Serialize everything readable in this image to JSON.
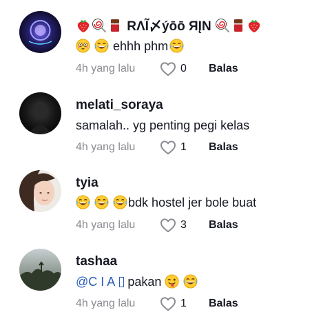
{
  "comments": [
    {
      "username": "RΛĨ〆ýōō ЯĮN",
      "text": "ehhh phm",
      "time": "4h yang lalu",
      "likes": "0",
      "reply_label": "Balas"
    },
    {
      "username": "melati_soraya",
      "text": "samalah.. yg penting pegi kelas",
      "time": "4h yang lalu",
      "likes": "1",
      "reply_label": "Balas"
    },
    {
      "username": "tyia",
      "text": "bdk hostel jer bole buat",
      "time": "4h yang lalu",
      "likes": "3",
      "reply_label": "Balas"
    },
    {
      "username": "tashaa",
      "mention": "@C I A",
      "text": "pakan",
      "time": "4h yang lalu",
      "likes": "1",
      "reply_label": "Balas"
    }
  ],
  "icons": {
    "like": "heart-outline-icon",
    "emoji_set_1": [
      "strawberry-emoji",
      "lollipop-emoji",
      "chocolate-bar-emoji"
    ],
    "emoji_flushed": "flushed-face-emoji",
    "emoji_laugh": "tears-of-joy-emoji",
    "emoji_tongue": "winking-tongue-emoji"
  },
  "colors": {
    "text_primary": "#161823",
    "text_secondary": "#8a8b91",
    "mention": "#2b5db9"
  }
}
